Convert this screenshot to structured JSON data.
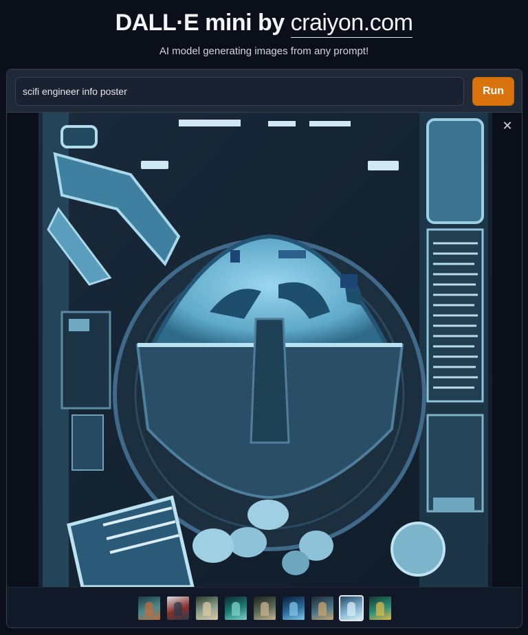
{
  "header": {
    "title_prefix": "DALL·E mini by ",
    "title_link": "craiyon.com",
    "subtitle": "AI model generating images from any prompt!"
  },
  "prompt": {
    "value": "scifi engineer info poster",
    "run_label": "Run"
  },
  "gallery": {
    "close_icon": "close-icon",
    "selected_index": 7,
    "thumbnail_count": 9
  },
  "colors": {
    "background": "#0b0f19",
    "panel": "#111827",
    "accent": "#d9730d"
  }
}
